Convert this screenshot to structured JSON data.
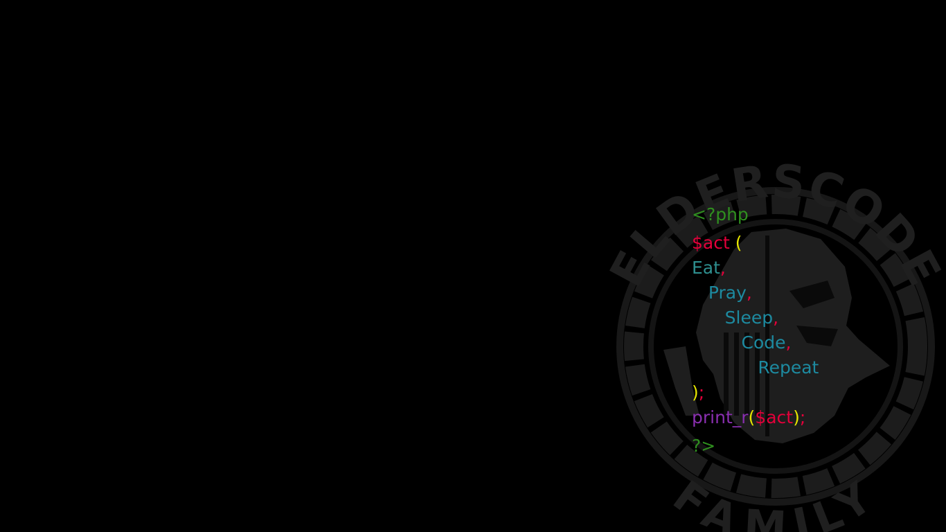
{
  "wallpaper": {
    "logo": {
      "top_text": "ELDERSCODE",
      "bottom_text": "FAMILY",
      "icon": "skull-emblem-icon"
    },
    "code_lines": [
      [
        {
          "text": "<?php",
          "color": "#2f8f1f"
        }
      ],
      [
        {
          "text": "$act",
          "color": "#e3003a"
        },
        {
          "text": " (",
          "color": "#e6e600"
        }
      ],
      [
        {
          "text": "Eat",
          "color": "#2e8f8f"
        },
        {
          "text": ",",
          "color": "#e3003a"
        }
      ],
      [
        {
          "text": "   Pray",
          "color": "#1d8aa0"
        },
        {
          "text": ",",
          "color": "#e3003a"
        }
      ],
      [
        {
          "text": "      Sleep",
          "color": "#1d8aa0"
        },
        {
          "text": ",",
          "color": "#e3003a"
        }
      ],
      [
        {
          "text": "         Code",
          "color": "#1d8aa0"
        },
        {
          "text": ",",
          "color": "#e3003a"
        }
      ],
      [
        {
          "text": "            Repeat",
          "color": "#1d8aa0"
        }
      ],
      [
        {
          "text": ")",
          "color": "#e6e600"
        },
        {
          "text": ";",
          "color": "#e3003a"
        }
      ],
      [
        {
          "text": "print_r",
          "color": "#8a2fb0"
        },
        {
          "text": "(",
          "color": "#e6e600"
        },
        {
          "text": "$act",
          "color": "#e3003a"
        },
        {
          "text": ")",
          "color": "#e6e600"
        },
        {
          "text": ";",
          "color": "#e3003a"
        }
      ],
      [
        {
          "text": "?>",
          "color": "#2f8f1f"
        }
      ]
    ],
    "colors": {
      "background": "#000000",
      "logo": "#1f1f1f",
      "logo_dark": "#141414"
    }
  }
}
